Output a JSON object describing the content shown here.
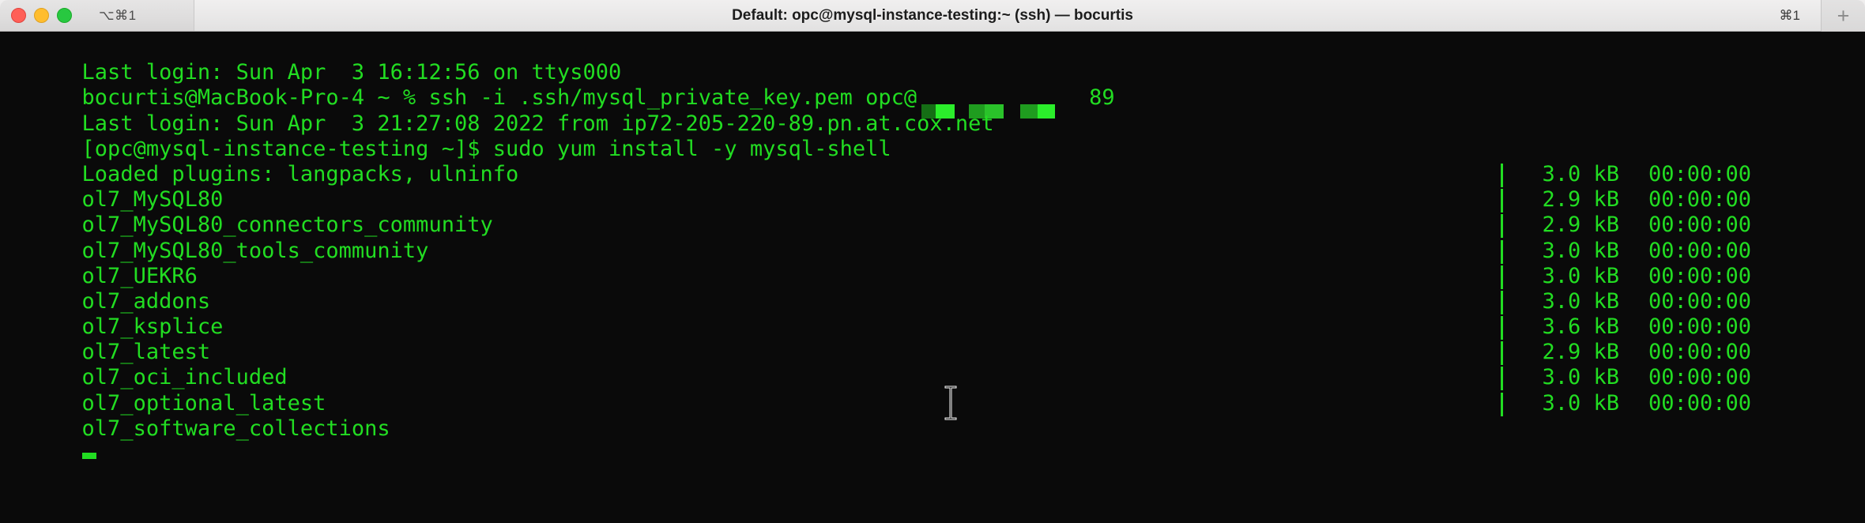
{
  "window": {
    "title": "Default: opc@mysql-instance-testing:~ (ssh) — bocurtis",
    "tab_shortcut": "⌥⌘1",
    "right_shortcut": "⌘1",
    "new_tab_label": "+",
    "traffic_lights": {
      "close": "close-button",
      "minimize": "minimize-button",
      "zoom": "zoom-button"
    },
    "colors": {
      "titlebar_bg": "#e9e8e8",
      "terminal_bg": "#0a0a0a",
      "terminal_fg": "#22dd22",
      "close": "#ff5f57",
      "minimize": "#ffbd2e",
      "maximize": "#28c840"
    }
  },
  "terminal": {
    "lines": [
      {
        "text": "Last login: Sun Apr  3 16:12:56 on ttys000"
      },
      {
        "text": "bocurtis@MacBook-Pro-4 ~ % ssh -i .ssh/mysql_private_key.pem opc@",
        "redacted": true,
        "suffix": "89"
      },
      {
        "text": "Last login: Sun Apr  3 21:27:08 2022 from ip72-205-220-89.pn.at.cox.net"
      },
      {
        "text": "[opc@mysql-instance-testing ~]$ sudo yum install -y mysql-shell"
      },
      {
        "text": "Loaded plugins: langpacks, ulninfo"
      }
    ],
    "repo_table": {
      "separator": "|",
      "rows": [
        {
          "name": "ol7_MySQL80",
          "size": "3.0 kB",
          "time": "00:00:00"
        },
        {
          "name": "ol7_MySQL80_connectors_community",
          "size": "2.9 kB",
          "time": "00:00:00"
        },
        {
          "name": "ol7_MySQL80_tools_community",
          "size": "2.9 kB",
          "time": "00:00:00"
        },
        {
          "name": "ol7_UEKR6",
          "size": "3.0 kB",
          "time": "00:00:00"
        },
        {
          "name": "ol7_addons",
          "size": "3.0 kB",
          "time": "00:00:00"
        },
        {
          "name": "ol7_ksplice",
          "size": "3.0 kB",
          "time": "00:00:00"
        },
        {
          "name": "ol7_latest",
          "size": "3.6 kB",
          "time": "00:00:00"
        },
        {
          "name": "ol7_oci_included",
          "size": "2.9 kB",
          "time": "00:00:00"
        },
        {
          "name": "ol7_optional_latest",
          "size": "3.0 kB",
          "time": "00:00:00"
        },
        {
          "name": "ol7_software_collections",
          "size": "3.0 kB",
          "time": "00:00:00"
        }
      ]
    },
    "prompt_cursor": "block-cursor",
    "mouse_cursor": "text-ibeam-cursor"
  }
}
